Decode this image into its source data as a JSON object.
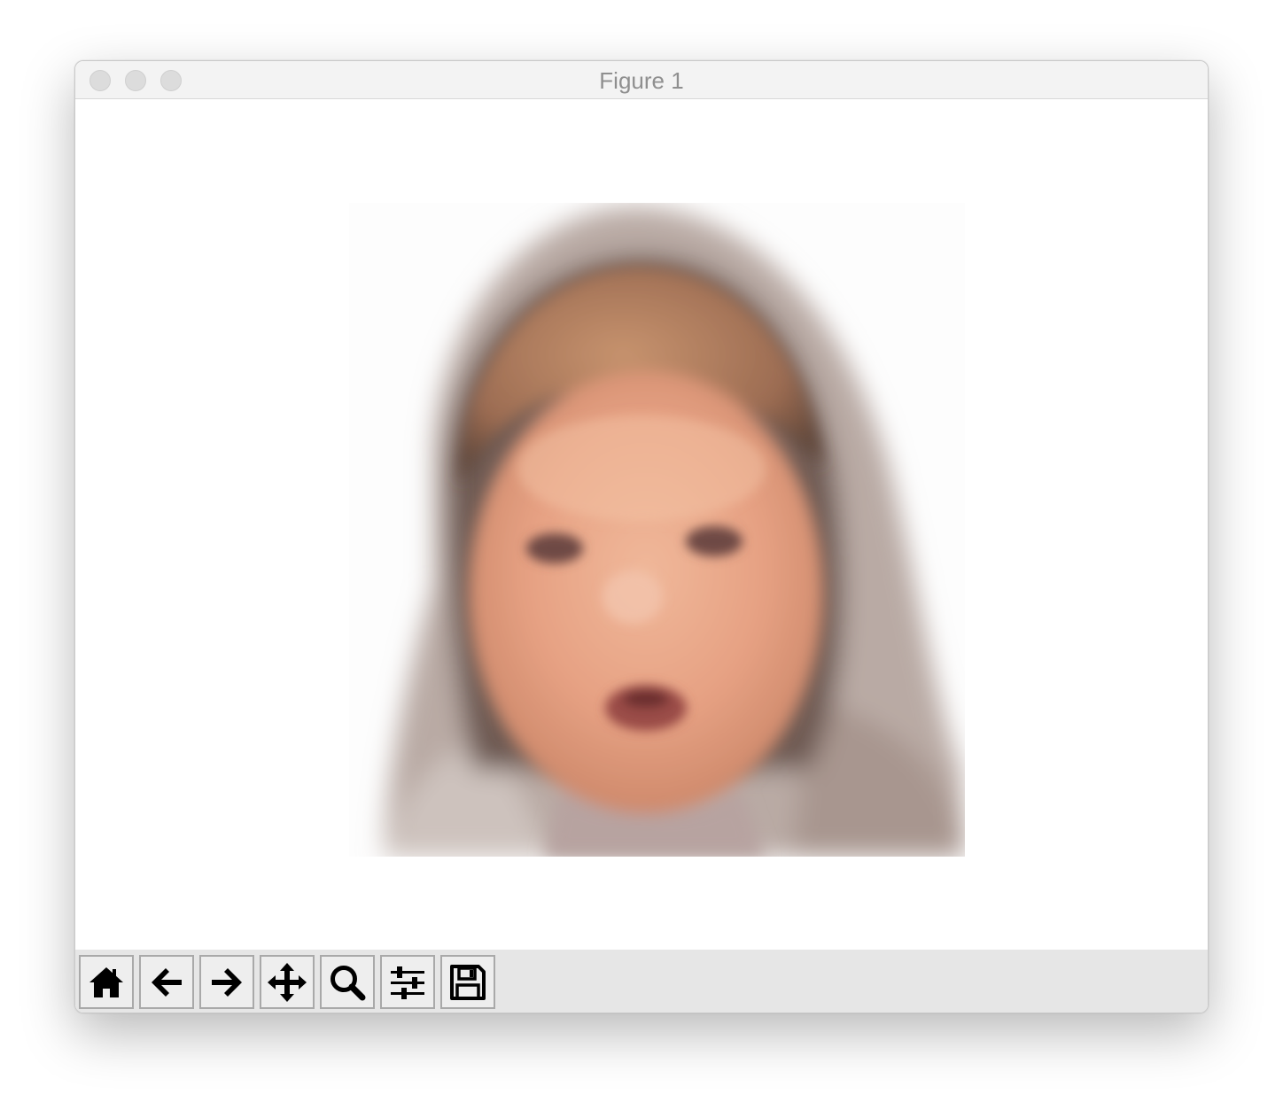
{
  "window": {
    "title": "Figure 1"
  },
  "canvas": {
    "image": "blurred-photo-of-baby-in-grey-hood"
  },
  "toolbar": {
    "buttons": [
      {
        "icon": "home-icon"
      },
      {
        "icon": "back-arrow-icon"
      },
      {
        "icon": "forward-arrow-icon"
      },
      {
        "icon": "pan-move-icon"
      },
      {
        "icon": "zoom-magnifier-icon"
      },
      {
        "icon": "configure-subplots-icon"
      },
      {
        "icon": "save-floppy-icon"
      }
    ]
  }
}
